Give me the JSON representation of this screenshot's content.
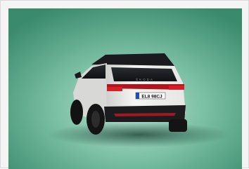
{
  "photo": {
    "subject": "electric-suv-rear-three-quarter-view",
    "background_color": "#5aa889",
    "car_body_color": "#f2f2f0",
    "roof_color": "#1b1b1d",
    "taillight_color": "#b0141c",
    "tailgate_lettering": "ŠKODA",
    "license_plate": "EL8 98CJ"
  }
}
